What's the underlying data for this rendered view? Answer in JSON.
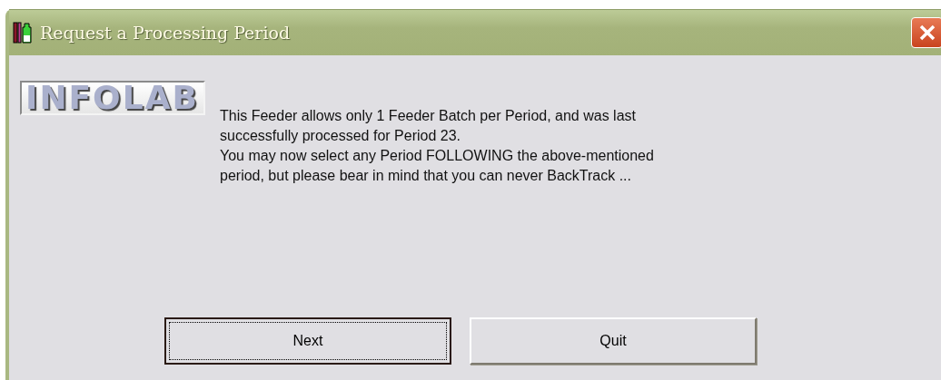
{
  "window": {
    "title": "Request a Processing Period"
  },
  "logo": {
    "text": "INFOLAB"
  },
  "message": "This Feeder allows only 1 Feeder Batch per Period, and was last\nsuccessfully processed for Period 23.\nYou may now select any Period FOLLOWING the above-mentioned\nperiod, but please bear in mind that you can never BackTrack ...",
  "buttons": [
    {
      "label": "Next",
      "focused": true
    },
    {
      "label": "Quit",
      "focused": false
    }
  ]
}
